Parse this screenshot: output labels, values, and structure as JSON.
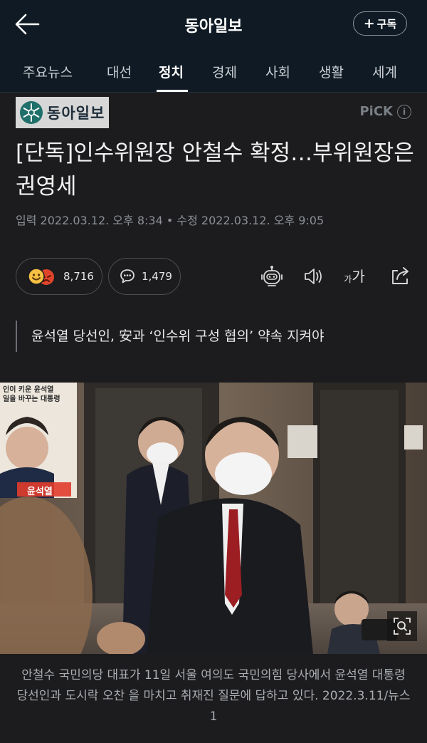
{
  "app": {
    "title": "동아일보",
    "subscribe_label": "구독"
  },
  "tabs": [
    {
      "label": "주요뉴스"
    },
    {
      "label": "대선"
    },
    {
      "label": "정치",
      "active": true
    },
    {
      "label": "경제"
    },
    {
      "label": "사회"
    },
    {
      "label": "생활"
    },
    {
      "label": "세계"
    }
  ],
  "article": {
    "press_name": "동아일보",
    "pick_label": "PiCK",
    "headline": "[단독]인수위원장 안철수 확정…부위원장은 권영세",
    "published": "입력 2022.03.12. 오후 8:34",
    "updated": "수정 2022.03.12. 오후 9:05",
    "reaction_count": "8,716",
    "comment_count": "1,479",
    "font_size_small": "가",
    "font_size_large": "가",
    "subheadline": "윤석열 당선인, 安과 ‘인수위 구성 협의’ 약속 지켜야",
    "photo_caption": "안철수 국민의당 대표가 11일 서울 여의도 국민의힘 당사에서 윤석열 대통령 당선인과 도시락 오찬 을 마치고 취재진 질문에 답하고 있다.  2022.3.11/뉴스1",
    "poster_text_1": "인이 키운 윤석열",
    "poster_text_2": "일을 바꾸는 대통령",
    "poster_name": "윤석열"
  },
  "colors": {
    "header_bg": "#0f1a24",
    "page_bg": "#1c1c1e",
    "accent_text": "#ffffff",
    "muted_text": "#8c9096"
  },
  "icons": {
    "back": "arrow-left-icon",
    "subscribe": "plus-icon",
    "logo": "snowflake-emblem-icon",
    "pick_info": "info-icon",
    "reactions": "emoji-reactions-icon",
    "comments": "speech-bubble-icon",
    "summary": "robot-icon",
    "tts": "speaker-icon",
    "font_size": "font-size-icon",
    "share": "share-icon",
    "zoom": "zoom-icon"
  }
}
